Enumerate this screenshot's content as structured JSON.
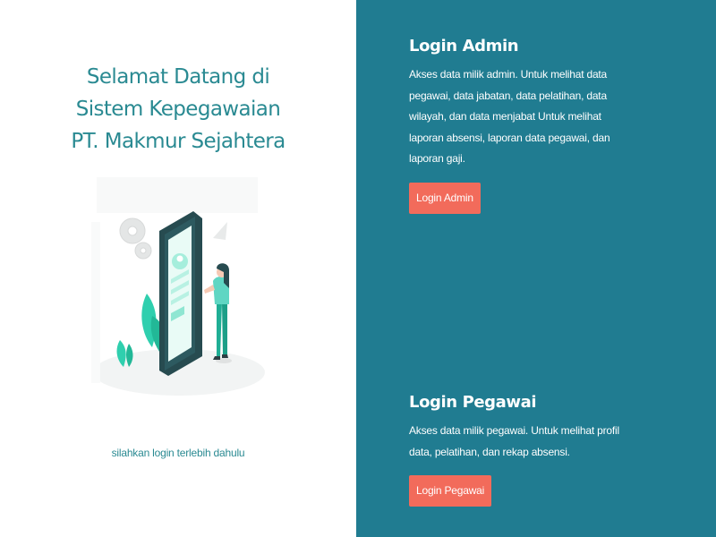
{
  "left_panel": {
    "welcome_lines": [
      "Selamat Datang di",
      "Sistem Kepegawaian",
      "PT. Makmur Sejahtera"
    ],
    "hint": "silahkan login terlebih dahulu",
    "illustration": "person-with-phone-illustration"
  },
  "admin": {
    "title": "Login Admin",
    "description": "Akses data milik admin. Untuk melihat data pegawai, data jabatan, data pelatihan, data wilayah, dan data menjabat Untuk melihat laporan absensi, laporan data pegawai, dan laporan gaji.",
    "button_label": "Login Admin"
  },
  "pegawai": {
    "title": "Login Pegawai",
    "description": "Akses data milik pegawai. Untuk melihat profil data, pelatihan, dan rekap absensi.",
    "button_label": "Login Pegawai"
  },
  "colors": {
    "panel_background": "#207c91",
    "accent_text": "#2a8a92",
    "button": "#f26b5b"
  }
}
